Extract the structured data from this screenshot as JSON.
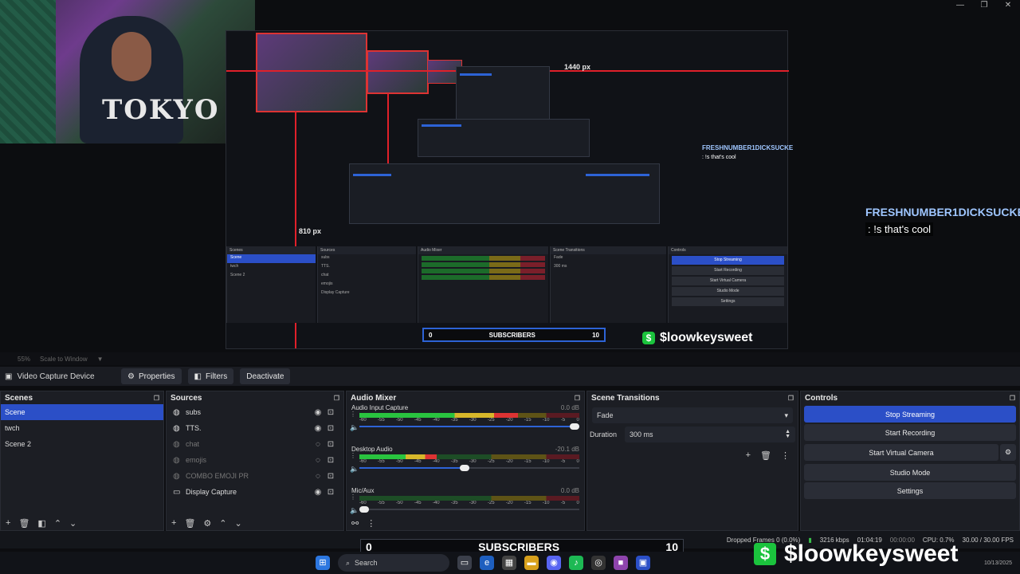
{
  "window_controls": [
    "—",
    "❐",
    "✕"
  ],
  "preview": {
    "width_label": "1440 px",
    "height_label": "810 px",
    "webcam_shirt_text": "TOKYO",
    "chat": {
      "user": "FRESHNUMBER1DICKSUCKE",
      "message": ": !s that's cool"
    },
    "subs_goal": {
      "current": "0",
      "label": "SUBSCRIBERS",
      "target": "10"
    },
    "cashtag": "$loowkeysweet"
  },
  "zoom": {
    "zoom_level": "55%",
    "scale_mode": "Scale to Window"
  },
  "source_toolbar": {
    "source_name": "Video Capture Device",
    "properties_label": "Properties",
    "filters_label": "Filters",
    "deactivate_label": "Deactivate"
  },
  "scenes": {
    "title": "Scenes",
    "items": [
      "Scene",
      "twch",
      "Scene 2"
    ]
  },
  "sources": {
    "title": "Sources",
    "items": [
      {
        "name": "subs",
        "icon": "globe-icon",
        "visible": true
      },
      {
        "name": "TTS.",
        "icon": "globe-icon",
        "visible": true
      },
      {
        "name": "chat",
        "icon": "globe-icon",
        "visible": false
      },
      {
        "name": "emojis",
        "icon": "globe-icon",
        "visible": false
      },
      {
        "name": "COMBO EMOJI PR",
        "icon": "globe-icon",
        "visible": false
      },
      {
        "name": "Display Capture",
        "icon": "monitor-icon",
        "visible": true
      }
    ]
  },
  "audio_mixer": {
    "title": "Audio Mixer",
    "tick_labels": [
      "-60",
      "-55",
      "-50",
      "-45",
      "-40",
      "-35",
      "-30",
      "-25",
      "-20",
      "-15",
      "-10",
      "-5",
      "0"
    ],
    "channels": [
      {
        "name": "Audio Input Capture",
        "db": "0.0 dB",
        "level": 0.72,
        "volume": 1.0
      },
      {
        "name": "Desktop Audio",
        "db": "-20.1 dB",
        "level": 0.35,
        "volume": 0.5
      },
      {
        "name": "Mic/Aux",
        "db": "0.0 dB",
        "level": 0.0,
        "volume": 0.0
      }
    ]
  },
  "scene_transitions": {
    "title": "Scene Transitions",
    "transition": "Fade",
    "duration_label": "Duration",
    "duration_value": "300 ms"
  },
  "controls": {
    "title": "Controls",
    "buttons": [
      "Stop Streaming",
      "Start Recording",
      "Start Virtual Camera",
      "Studio Mode",
      "Settings"
    ]
  },
  "status": {
    "dropped_frames": "Dropped Frames 0 (0.0%)",
    "bitrate": "3216 kbps",
    "stream_time": "01:04:19",
    "rec_time": "00:00:00",
    "cpu": "CPU: 0.7%",
    "fps": "30.00 / 30.00 FPS"
  },
  "taskbar": {
    "search_label": "Search",
    "date": "10/13/2025"
  },
  "colors": {
    "accent": "#2b4fc7",
    "cash_green": "#1bc33d",
    "guide_red": "#e0202a"
  }
}
